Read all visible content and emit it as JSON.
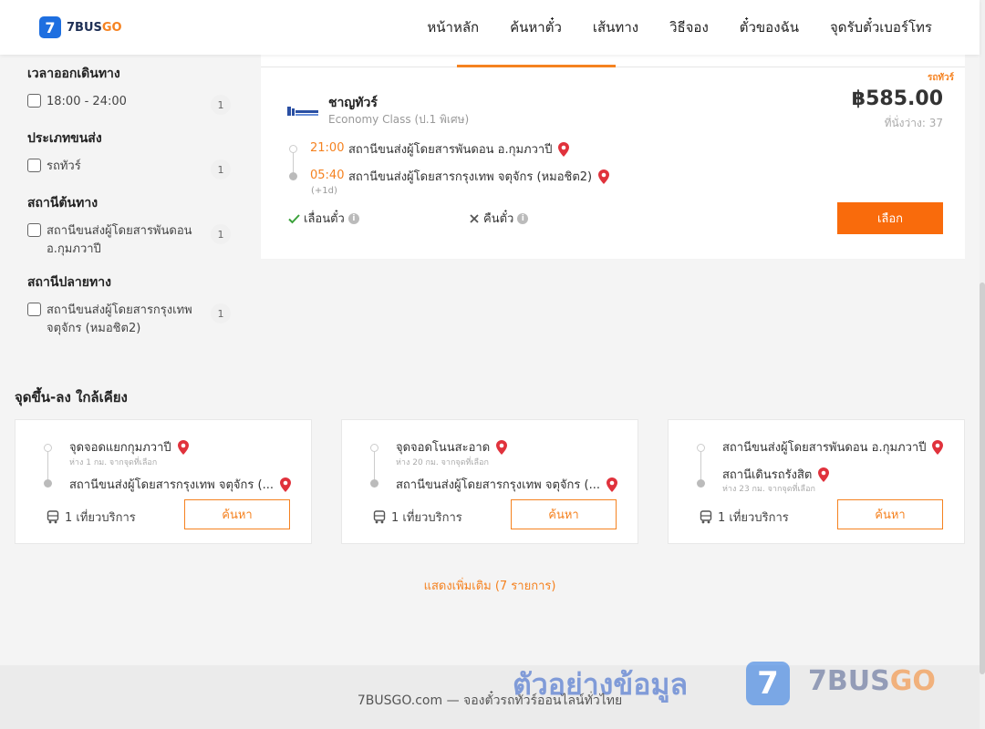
{
  "header": {
    "logo_number": "7",
    "logo_text_main": "7BUS",
    "logo_text_accent": "GO",
    "nav": [
      "หน้าหลัก",
      "ค้นหาตั๋ว",
      "เส้นทาง",
      "วิธีจอง",
      "ตั๋วของฉัน",
      "จุดรับตั๋วเบอร์โทร"
    ]
  },
  "filters": {
    "departure_time": {
      "title": "เวลาออกเดินทาง",
      "option": "18:00 - 24:00",
      "count": "1"
    },
    "transport_type": {
      "title": "ประเภทขนส่ง",
      "option": "รถทัวร์",
      "count": "1"
    },
    "origin": {
      "title": "สถานีต้นทาง",
      "option": "สถานีขนส่งผู้โดยสารพันดอน อ.กุมภวาปี",
      "count": "1"
    },
    "destination": {
      "title": "สถานีปลายทาง",
      "option": "สถานีขนส่งผู้โดยสารกรุงเทพ จตุจักร (หมอชิต2)",
      "count": "1"
    }
  },
  "result": {
    "tag": "รถทัวร์",
    "operator_name": "ชาญทัวร์",
    "service_class": "Economy Class (ป.1 พิเศษ)",
    "price": "฿585.00",
    "seats": "ที่นั่งว่าง: 37",
    "depart_time": "21:00",
    "depart_station": "สถานีขนส่งผู้โดยสารพันดอน อ.กุมภวาปี",
    "arrive_time": "05:40",
    "arrive_station": "สถานีขนส่งผู้โดยสารกรุงเทพ จตุจักร (หมอชิต2)",
    "plus_day": "(+1d)",
    "feature_reschedule": "เลื่อนตั๋ว",
    "feature_refund": "คืนตั๋ว",
    "select_label": "เลือก"
  },
  "nearby": {
    "title": "จุดขึ้น-ลง ใกล้เคียง",
    "cards": [
      {
        "from": "จุดจอดแยกกุมภวาปี",
        "from_dist": "ห่าง 1 กม. จากจุดที่เลือก",
        "to": "สถานีขนส่งผู้โดยสารกรุงเทพ จตุจักร (...",
        "to_dist": "",
        "trips": "1 เที่ยวบริการ",
        "button": "ค้นหา"
      },
      {
        "from": "จุดจอดโนนสะอาด",
        "from_dist": "ห่าง 20 กม. จากจุดที่เลือก",
        "to": "สถานีขนส่งผู้โดยสารกรุงเทพ จตุจักร (...",
        "to_dist": "",
        "trips": "1 เที่ยวบริการ",
        "button": "ค้นหา"
      },
      {
        "from": "สถานีขนส่งผู้โดยสารพันดอน อ.กุมภวาปี",
        "from_dist": "",
        "to": "สถานีเดินรถรังสิต",
        "to_dist": "ห่าง 23 กม. จากจุดที่เลือก",
        "trips": "1 เที่ยวบริการ",
        "button": "ค้นหา"
      }
    ],
    "show_more": "แสดงเพิ่มเติม (7 รายการ)"
  },
  "footer": {
    "text": "7BUSGO.com — จองตั๋วรถทัวร์ออนไลน์ทั่วไทย",
    "watermark_text": "ตัวอย่างข้อมูล",
    "watermark_number": "7",
    "watermark_brand_main": "7BUS",
    "watermark_brand_accent": "GO"
  },
  "colors": {
    "accent": "#f58220",
    "button": "#f96b0c",
    "brand_blue": "#1e6fe0",
    "pin": "#e0323c"
  }
}
